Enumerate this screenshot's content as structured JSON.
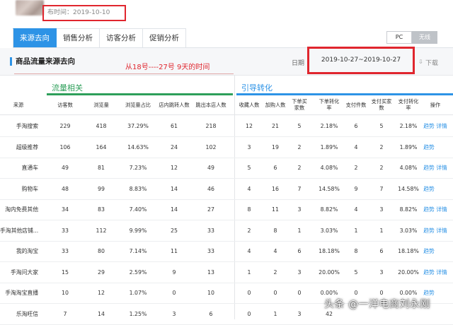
{
  "header": {
    "publish_time": "布时间：2019-10-10"
  },
  "tabs": [
    {
      "label": "来源去向",
      "active": true
    },
    {
      "label": "销售分析",
      "active": false
    },
    {
      "label": "访客分析",
      "active": false
    },
    {
      "label": "促销分析",
      "active": false
    }
  ],
  "device_toggle": {
    "pc": "PC",
    "wireless": "无线",
    "selected": "无线"
  },
  "panel": {
    "title": "商品流量来源去向",
    "annotation": "从18号----27号   9天的时间",
    "date_label": "日期",
    "date_range": "2019-10-27~2019-10-27",
    "download_label": "下载",
    "download_icon": "download-arrow-icon"
  },
  "groups": {
    "traffic": "流量相关",
    "conversion": "引导转化"
  },
  "columns": {
    "source": "来源",
    "visitors": "访客数",
    "views": "浏览量",
    "view_share": "浏览量占比",
    "in_store_jump": "店内跳转人数",
    "out_store_jump": "跳出本店人数",
    "favorites": "收藏人数",
    "add_cart": "加购人数",
    "order_buyers": "下单买家数",
    "order_rate": "下单转化率",
    "pay_items": "支付件数",
    "pay_buyers": "支付买家数",
    "pay_rate": "支付转化率",
    "actions": "操作"
  },
  "rows": [
    {
      "source": "手淘搜索",
      "visitors": "229",
      "views": "418",
      "view_share": "37.29%",
      "in_store_jump": "61",
      "out_store_jump": "218",
      "favorites": "12",
      "add_cart": "21",
      "order_buyers": "5",
      "order_rate": "2.18%",
      "pay_items": "6",
      "pay_buyers": "5",
      "pay_rate": "2.18%",
      "trend": "趋势",
      "detail": "详情"
    },
    {
      "source": "超级推荐",
      "visitors": "106",
      "views": "164",
      "view_share": "14.63%",
      "in_store_jump": "24",
      "out_store_jump": "102",
      "favorites": "3",
      "add_cart": "19",
      "order_buyers": "2",
      "order_rate": "1.89%",
      "pay_items": "4",
      "pay_buyers": "2",
      "pay_rate": "1.89%",
      "trend": "趋势",
      "detail": ""
    },
    {
      "source": "直通车",
      "visitors": "49",
      "views": "81",
      "view_share": "7.23%",
      "in_store_jump": "12",
      "out_store_jump": "49",
      "favorites": "5",
      "add_cart": "6",
      "order_buyers": "2",
      "order_rate": "4.08%",
      "pay_items": "2",
      "pay_buyers": "2",
      "pay_rate": "4.08%",
      "trend": "趋势",
      "detail": "详情"
    },
    {
      "source": "购物车",
      "visitors": "48",
      "views": "99",
      "view_share": "8.83%",
      "in_store_jump": "14",
      "out_store_jump": "46",
      "favorites": "4",
      "add_cart": "16",
      "order_buyers": "7",
      "order_rate": "14.58%",
      "pay_items": "9",
      "pay_buyers": "7",
      "pay_rate": "14.58%",
      "trend": "趋势",
      "detail": ""
    },
    {
      "source": "淘内免费其他",
      "visitors": "34",
      "views": "83",
      "view_share": "7.40%",
      "in_store_jump": "14",
      "out_store_jump": "27",
      "favorites": "8",
      "add_cart": "11",
      "order_buyers": "3",
      "order_rate": "8.82%",
      "pay_items": "4",
      "pay_buyers": "3",
      "pay_rate": "8.82%",
      "trend": "趋势",
      "detail": "详情"
    },
    {
      "source": "手淘其他店铺...",
      "visitors": "33",
      "views": "112",
      "view_share": "9.99%",
      "in_store_jump": "25",
      "out_store_jump": "33",
      "favorites": "2",
      "add_cart": "8",
      "order_buyers": "1",
      "order_rate": "3.03%",
      "pay_items": "1",
      "pay_buyers": "1",
      "pay_rate": "3.03%",
      "trend": "趋势",
      "detail": "详情"
    },
    {
      "source": "我的淘宝",
      "visitors": "33",
      "views": "80",
      "view_share": "7.14%",
      "in_store_jump": "11",
      "out_store_jump": "33",
      "favorites": "4",
      "add_cart": "4",
      "order_buyers": "6",
      "order_rate": "18.18%",
      "pay_items": "8",
      "pay_buyers": "6",
      "pay_rate": "18.18%",
      "trend": "趋势",
      "detail": ""
    },
    {
      "source": "手淘问大家",
      "visitors": "15",
      "views": "29",
      "view_share": "2.59%",
      "in_store_jump": "9",
      "out_store_jump": "13",
      "favorites": "1",
      "add_cart": "2",
      "order_buyers": "3",
      "order_rate": "20.00%",
      "pay_items": "5",
      "pay_buyers": "3",
      "pay_rate": "20.00%",
      "trend": "趋势",
      "detail": "详情"
    },
    {
      "source": "手淘淘宝直播",
      "visitors": "10",
      "views": "12",
      "view_share": "1.07%",
      "in_store_jump": "0",
      "out_store_jump": "10",
      "favorites": "0",
      "add_cart": "0",
      "order_buyers": "0",
      "order_rate": "0.00%",
      "pay_items": "0",
      "pay_buyers": "0",
      "pay_rate": "0.00%",
      "trend": "趋势",
      "detail": ""
    },
    {
      "source": "乐淘旺信",
      "visitors": "7",
      "views": "14",
      "view_share": "1.25%",
      "in_store_jump": "3",
      "out_store_jump": "6",
      "favorites": "0",
      "add_cart": "1",
      "order_buyers": "3",
      "order_rate": "42",
      "pay_items": "",
      "pay_buyers": "",
      "pay_rate": "",
      "trend": "",
      "detail": ""
    }
  ],
  "watermark": "头条 @一洋电商刘永刚"
}
